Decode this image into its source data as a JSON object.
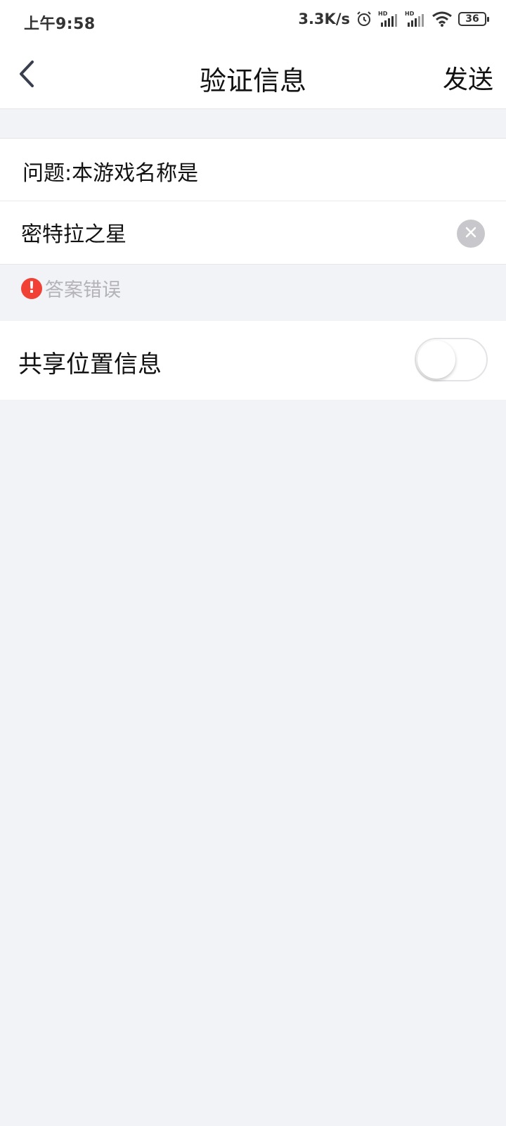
{
  "status_bar": {
    "time": "上午9:58",
    "network_speed": "3.3K/s",
    "battery": "36",
    "icons": [
      "alarm-icon",
      "signal-hd-icon",
      "signal-hd-icon",
      "wifi-icon",
      "battery-icon"
    ]
  },
  "nav": {
    "title": "验证信息",
    "send_label": "发送",
    "back_icon": "chevron-left-icon"
  },
  "form": {
    "question": "问题:本游戏名称是",
    "answer_value": "密特拉之星",
    "clear_icon": "clear-icon",
    "error_message": "答案错误",
    "error_icon_glyph": "!"
  },
  "location": {
    "label": "共享位置信息",
    "toggle_on": false
  },
  "colors": {
    "background": "#f2f3f7",
    "error": "#f04134",
    "hint_text": "#b3b3b8"
  }
}
